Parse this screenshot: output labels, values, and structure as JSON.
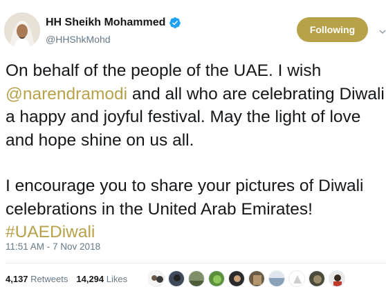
{
  "header": {
    "display_name": "HH Sheikh Mohammed",
    "handle": "@HHShkMohd",
    "follow_label": "Following",
    "accent_color": "#b7a24a"
  },
  "tweet": {
    "p1_before": "On behalf of the people of the UAE. I wish ",
    "p1_mention": "@narendramodi",
    "p1_after": " and all who are celebrating Diwali a happy and joyful festival. May the light of love and hope shine on us all.",
    "p2_before": "I encourage you to share your pictures of Diwali celebrations in the United Arab Emirates! ",
    "p2_hashtag": "#UAEDiwali",
    "timestamp": "11:51 AM - 7 Nov 2018"
  },
  "stats": {
    "retweets_count": "4,137",
    "retweets_label": "Retweets",
    "likes_count": "14,294",
    "likes_label": "Likes"
  },
  "likers": [
    {
      "icon": "avatar-1"
    },
    {
      "icon": "avatar-2"
    },
    {
      "icon": "avatar-3"
    },
    {
      "icon": "avatar-4"
    },
    {
      "icon": "avatar-5"
    },
    {
      "icon": "avatar-6"
    },
    {
      "icon": "avatar-7"
    },
    {
      "icon": "avatar-8"
    },
    {
      "icon": "avatar-9"
    },
    {
      "icon": "avatar-10"
    }
  ]
}
